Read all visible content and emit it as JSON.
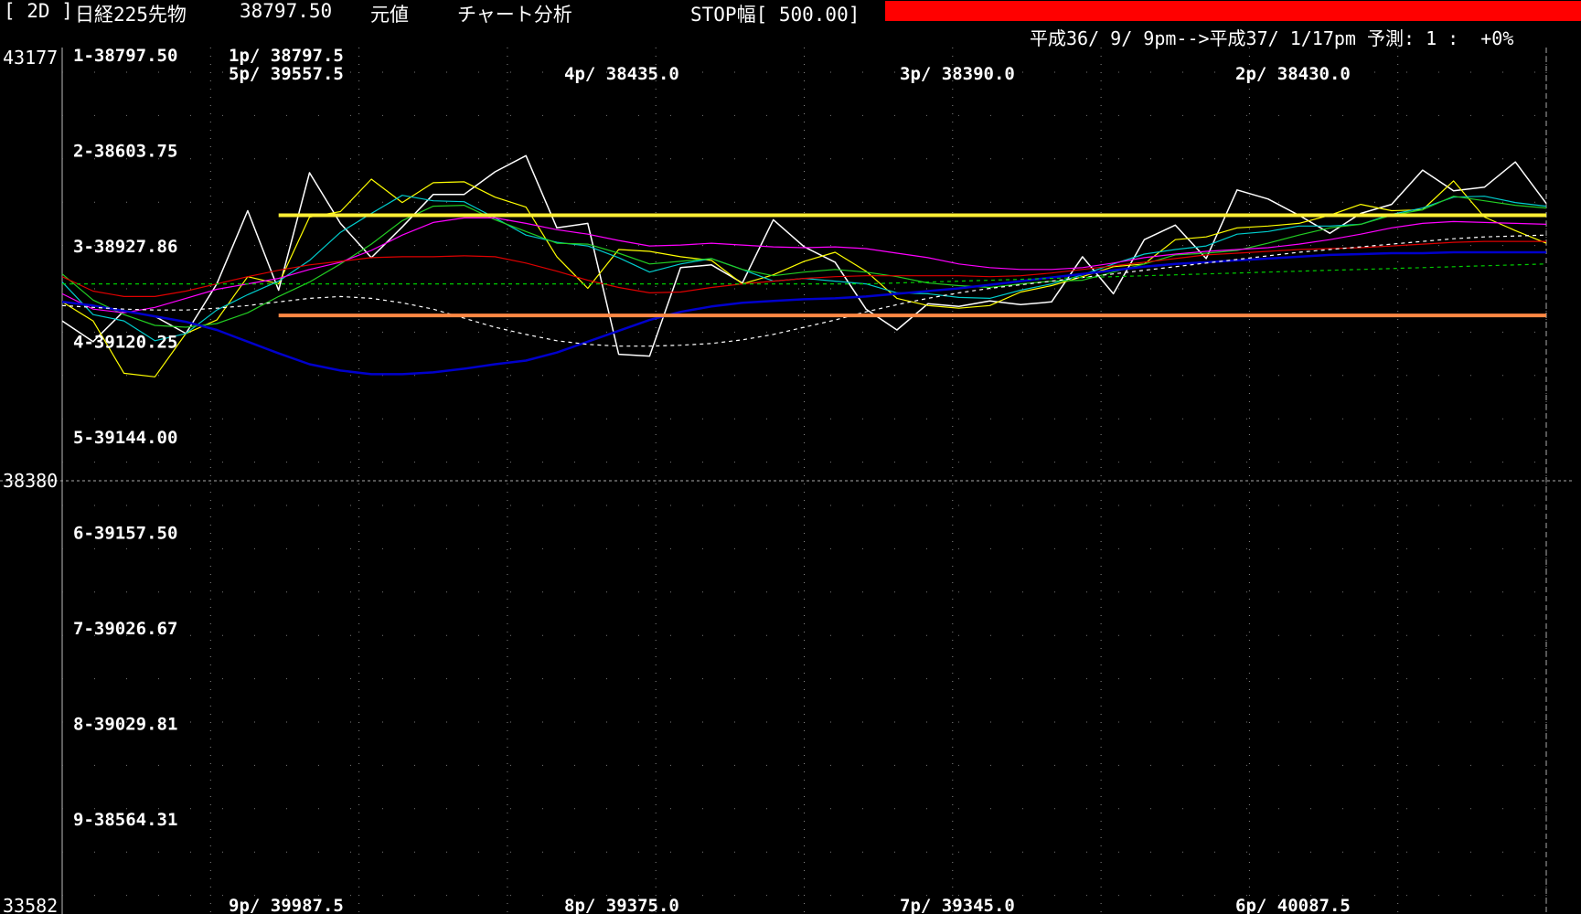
{
  "header": {
    "period": "[ 2D ]",
    "instrument": "日経225先物",
    "price": "38797.50",
    "mode": "元値",
    "analysis": "チャート分析",
    "stop": "STOP幅[ 500.00]",
    "range": "平成36/ 9/ 9pm-->平成37/ 1/17pm 予測: 1 :  +0%",
    "stop_color": "#ff0000"
  },
  "chart_data": {
    "type": "line",
    "y_axis": {
      "top": "43177",
      "mid": "38380",
      "bottom": "33582",
      "ylim": [
        33582,
        43177
      ]
    },
    "level_labels": [
      "1-38797.50",
      "2-38603.75",
      "3-38927.86",
      "4-39120.25",
      "5-39144.00",
      "6-39157.50",
      "7-39026.67",
      "8-39029.81",
      "9-38564.31"
    ],
    "pivots_top": [
      {
        "col": 1,
        "labels": [
          "1p/ 38797.5",
          "5p/ 39557.5"
        ]
      },
      {
        "col": 2,
        "labels": [
          "4p/ 38435.0"
        ]
      },
      {
        "col": 3,
        "labels": [
          "3p/ 38390.0"
        ]
      },
      {
        "col": 4,
        "labels": [
          "2p/ 38430.0"
        ]
      }
    ],
    "pivots_bottom": [
      "9p/ 39987.5",
      "8p/ 39375.0",
      "7p/ 39345.0",
      "6p/ 40087.5"
    ],
    "n_points": 49,
    "series": [
      {
        "color": "#ffffff",
        "width": 1.5,
        "values": [
          40150,
          39920,
          40260,
          40200,
          40010,
          40560,
          41370,
          40490,
          41790,
          41230,
          40850,
          41190,
          41550,
          41550,
          41800,
          41980,
          41180,
          41230,
          39780,
          39760,
          40740,
          40770,
          40570,
          41270,
          40970,
          40800,
          40280,
          40050,
          40340,
          40310,
          40370,
          40330,
          40360,
          40860,
          40450,
          41050,
          41210,
          40840,
          41600,
          41500,
          41320,
          41120,
          41340,
          41440,
          41820,
          41590,
          41630,
          41910,
          41450
        ]
      },
      {
        "color": "#ffff00",
        "width": 1.2,
        "values": [
          40360,
          40150,
          39570,
          39530,
          40010,
          40160,
          40640,
          40560,
          41300,
          41360,
          41720,
          41460,
          41680,
          41690,
          41520,
          41410,
          40860,
          40510,
          40940,
          40920,
          40860,
          40820,
          40560,
          40660,
          40810,
          40910,
          40700,
          40400,
          40320,
          40290,
          40320,
          40470,
          40540,
          40640,
          40750,
          40780,
          41050,
          41080,
          41180,
          41200,
          41230,
          41320,
          41440,
          41370,
          41380,
          41700,
          41300,
          41150,
          41010
        ]
      },
      {
        "color": "#00cccc",
        "width": 1.2,
        "values": [
          40580,
          40220,
          40150,
          39930,
          40010,
          40270,
          40440,
          40590,
          40820,
          41130,
          41340,
          41540,
          41480,
          41470,
          41290,
          41100,
          41020,
          40980,
          40850,
          40690,
          40780,
          40840,
          40720,
          40590,
          40620,
          40590,
          40560,
          40460,
          40450,
          40410,
          40400,
          40490,
          40560,
          40660,
          40780,
          40890,
          40940,
          40980,
          41110,
          41140,
          41200,
          41200,
          41220,
          41330,
          41400,
          41520,
          41530,
          41460,
          41420
        ]
      },
      {
        "color": "#22cc22",
        "width": 1.2,
        "values": [
          40670,
          40380,
          40220,
          40100,
          40080,
          40120,
          40240,
          40420,
          40580,
          40780,
          41000,
          41260,
          41420,
          41430,
          41270,
          41140,
          41010,
          41000,
          40900,
          40780,
          40810,
          40840,
          40720,
          40650,
          40690,
          40720,
          40690,
          40640,
          40570,
          40540,
          40520,
          40560,
          40590,
          40600,
          40690,
          40780,
          40880,
          40900,
          40930,
          41010,
          41100,
          41180,
          41220,
          41320,
          41380,
          41530,
          41480,
          41430,
          41400
        ]
      },
      {
        "color": "#ff00ff",
        "width": 1.2,
        "values": [
          40450,
          40280,
          40240,
          40300,
          40400,
          40500,
          40560,
          40620,
          40720,
          40800,
          40930,
          41100,
          41240,
          41290,
          41290,
          41230,
          41160,
          41110,
          41040,
          40980,
          40990,
          41010,
          40990,
          40970,
          40960,
          40970,
          40950,
          40900,
          40850,
          40780,
          40740,
          40720,
          40720,
          40740,
          40790,
          40850,
          40890,
          40920,
          40940,
          40960,
          41000,
          41050,
          41110,
          41180,
          41230,
          41250,
          41240,
          41230,
          41220
        ]
      },
      {
        "color": "#dd0000",
        "width": 1.2,
        "values": [
          40640,
          40480,
          40420,
          40420,
          40480,
          40560,
          40640,
          40710,
          40770,
          40810,
          40850,
          40860,
          40860,
          40870,
          40860,
          40790,
          40700,
          40600,
          40520,
          40460,
          40470,
          40520,
          40560,
          40590,
          40620,
          40640,
          40650,
          40650,
          40650,
          40650,
          40640,
          40650,
          40680,
          40720,
          40760,
          40800,
          40840,
          40880,
          40900,
          40920,
          40940,
          40950,
          40960,
          40980,
          41000,
          41020,
          41030,
          41030,
          41030
        ]
      },
      {
        "color": "#0000cc",
        "width": 2.5,
        "values": [
          40360,
          40320,
          40260,
          40200,
          40140,
          40050,
          39920,
          39790,
          39670,
          39600,
          39560,
          39560,
          39580,
          39620,
          39670,
          39710,
          39800,
          39920,
          40040,
          40160,
          40250,
          40310,
          40350,
          40370,
          40390,
          40400,
          40420,
          40450,
          40480,
          40510,
          40550,
          40590,
          40630,
          40670,
          40710,
          40750,
          40780,
          40800,
          40820,
          40840,
          40860,
          40880,
          40890,
          40900,
          40900,
          40910,
          40910,
          40910,
          40910
        ]
      },
      {
        "color": "#ffffff",
        "width": 1.2,
        "dash": "4,4",
        "values": [
          40320,
          40300,
          40280,
          40270,
          40270,
          40290,
          40320,
          40360,
          40400,
          40420,
          40400,
          40350,
          40280,
          40180,
          40080,
          40000,
          39930,
          39890,
          39870,
          39870,
          39880,
          39900,
          39940,
          40000,
          40080,
          40160,
          40250,
          40330,
          40400,
          40460,
          40510,
          40550,
          40590,
          40630,
          40670,
          40710,
          40750,
          40790,
          40830,
          40870,
          40910,
          40940,
          40970,
          41000,
          41030,
          41060,
          41080,
          41090,
          41100
        ]
      },
      {
        "color": "#00cc00",
        "width": 1.2,
        "dash": "4,4",
        "values": [
          40560,
          40560,
          40560,
          40560,
          40560,
          40560,
          40560,
          40560,
          40560,
          40560,
          40560,
          40560,
          40560,
          40560,
          40560,
          40560,
          40560,
          40560,
          40560,
          40560,
          40560,
          40560,
          40560,
          40560,
          40560,
          40560,
          40560,
          40570,
          40580,
          40590,
          40600,
          40610,
          40620,
          40630,
          40640,
          40650,
          40660,
          40670,
          40680,
          40690,
          40700,
          40710,
          40720,
          40730,
          40740,
          40750,
          40760,
          40770,
          40780
        ]
      }
    ],
    "annotations": [
      {
        "type": "hline",
        "color": "#ffee33",
        "value": 41320,
        "from_col": 7,
        "to_col": 48
      },
      {
        "type": "hline",
        "color": "#ff8844",
        "value": 40210,
        "from_col": 7,
        "to_col": 48
      }
    ],
    "vgrid_cols": 5,
    "grid": true
  }
}
